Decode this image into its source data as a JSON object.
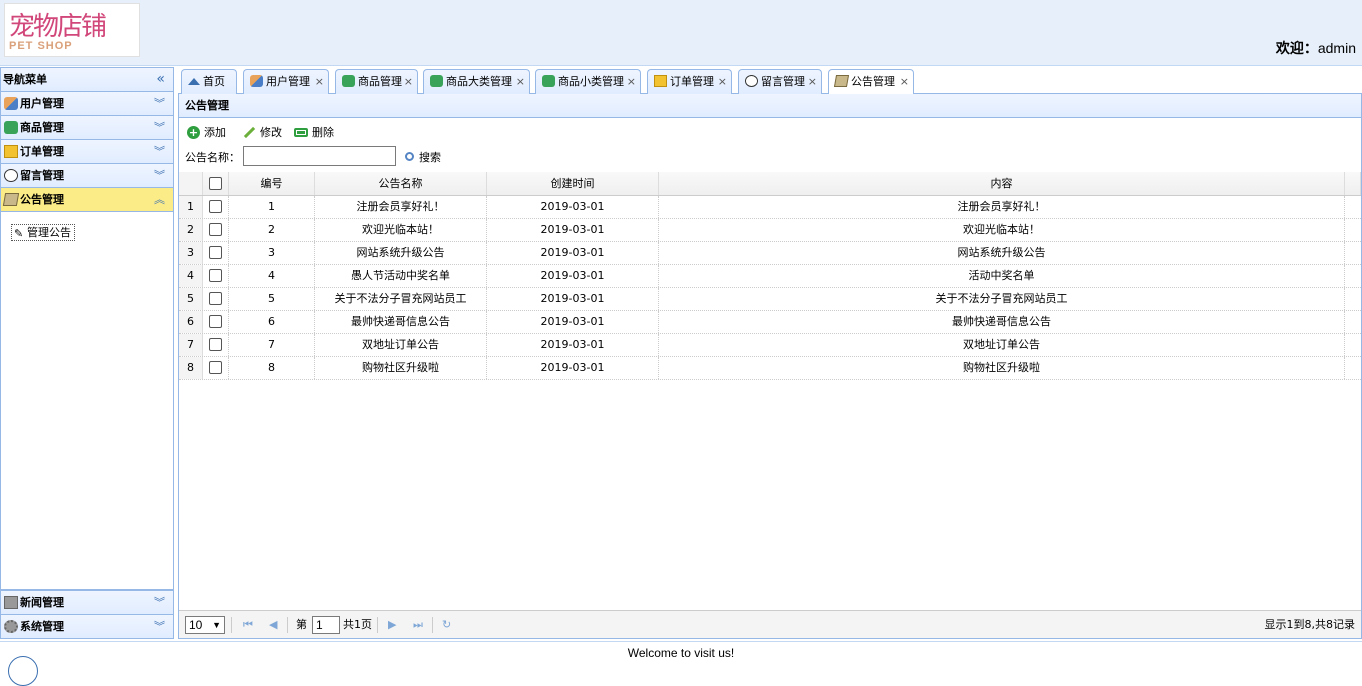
{
  "header": {
    "logo_cn": "宠物店铺",
    "logo_en": "PET SHOP",
    "welcome_label": "欢迎：",
    "username": "admin"
  },
  "nav": {
    "title": "导航菜单",
    "collapse_icon": "«",
    "sections": [
      {
        "label": "用户管理",
        "icon": "user-icon"
      },
      {
        "label": "商品管理",
        "icon": "goods-icon"
      },
      {
        "label": "订单管理",
        "icon": "order-icon"
      },
      {
        "label": "留言管理",
        "icon": "message-icon"
      },
      {
        "label": "公告管理",
        "icon": "notice-icon",
        "selected": true
      }
    ],
    "active_leaf": "管理公告",
    "bottom_sections": [
      {
        "label": "新闻管理",
        "icon": "news-icon"
      },
      {
        "label": "系统管理",
        "icon": "settings-icon"
      }
    ]
  },
  "tabs": [
    {
      "label": "首页",
      "icon": "home-icon",
      "closable": false
    },
    {
      "label": "用户管理",
      "icon": "user-icon",
      "closable": true
    },
    {
      "label": "商品管理",
      "icon": "goods-icon",
      "closable": true
    },
    {
      "label": "商品大类管理",
      "icon": "goods-icon",
      "closable": true
    },
    {
      "label": "商品小类管理",
      "icon": "goods-icon",
      "closable": true
    },
    {
      "label": "订单管理",
      "icon": "order-icon",
      "closable": true
    },
    {
      "label": "留言管理",
      "icon": "message-icon",
      "closable": true
    },
    {
      "label": "公告管理",
      "icon": "notice-icon",
      "closable": true,
      "active": true
    }
  ],
  "tab_close": "×",
  "panel": {
    "title": "公告管理",
    "toolbar": {
      "add": "添加",
      "edit": "修改",
      "delete": "删除"
    },
    "search": {
      "label": "公告名称：",
      "value": "",
      "button": "搜索"
    }
  },
  "grid": {
    "columns": [
      "编号",
      "公告名称",
      "创建时间",
      "内容"
    ],
    "rows": [
      {
        "rn": "1",
        "id": "1",
        "name": "注册会员享好礼！",
        "date": "2019-03-01",
        "content": "注册会员享好礼！"
      },
      {
        "rn": "2",
        "id": "2",
        "name": "欢迎光临本站！",
        "date": "2019-03-01",
        "content": "欢迎光临本站！"
      },
      {
        "rn": "3",
        "id": "3",
        "name": "网站系统升级公告",
        "date": "2019-03-01",
        "content": "网站系统升级公告"
      },
      {
        "rn": "4",
        "id": "4",
        "name": "愚人节活动中奖名单",
        "date": "2019-03-01",
        "content": "活动中奖名单"
      },
      {
        "rn": "5",
        "id": "5",
        "name": "关于不法分子冒充网站员工",
        "date": "2019-03-01",
        "content": "关于不法分子冒充网站员工"
      },
      {
        "rn": "6",
        "id": "6",
        "name": "最帅快递哥信息公告",
        "date": "2019-03-01",
        "content": "最帅快递哥信息公告"
      },
      {
        "rn": "7",
        "id": "7",
        "name": "双地址订单公告",
        "date": "2019-03-01",
        "content": "双地址订单公告"
      },
      {
        "rn": "8",
        "id": "8",
        "name": "购物社区升级啦",
        "date": "2019-03-01",
        "content": "购物社区升级啦"
      }
    ]
  },
  "pager": {
    "page_size": "10",
    "page_prefix": "第",
    "page_number": "1",
    "page_total": "共1页",
    "info": "显示1到8,共8记录"
  },
  "footer": {
    "text": "Welcome to visit us!"
  }
}
